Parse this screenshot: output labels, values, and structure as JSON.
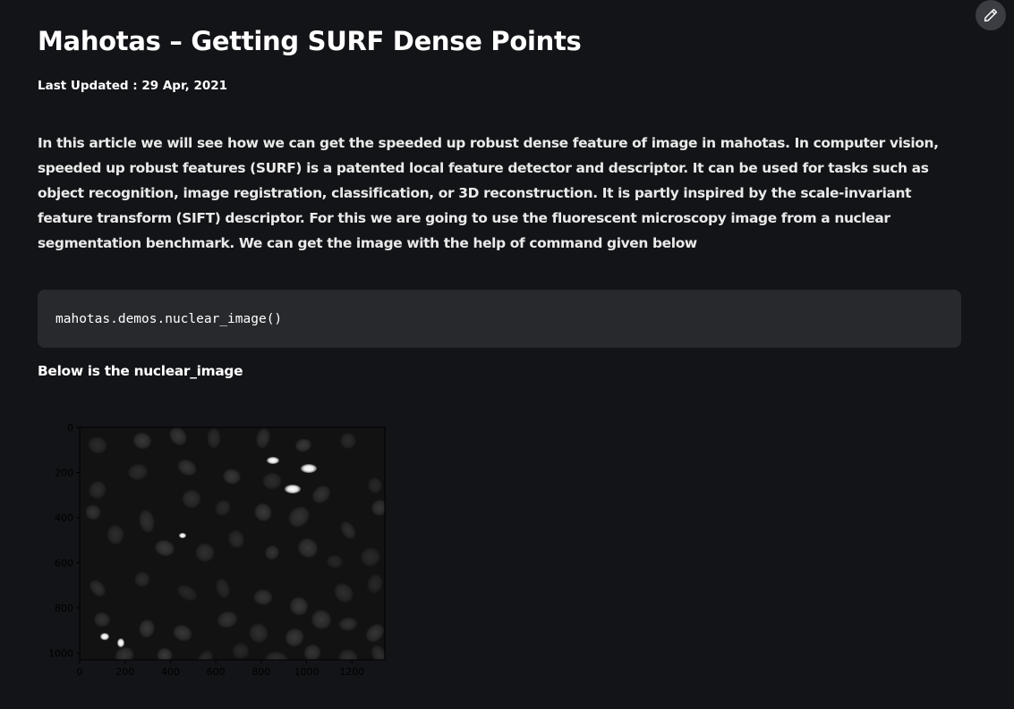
{
  "header": {
    "edit_icon": "pencil-icon"
  },
  "article": {
    "title": "Mahotas – Getting SURF Dense Points",
    "last_updated": "Last Updated : 29 Apr, 2021",
    "intro": "In this article we will see how we can get the speeded up robust dense feature of image in mahotas. In computer vision, speeded up robust features (SURF) is a patented local feature detector and descriptor. It can be used for tasks such as object recognition, image registration, classification, or 3D reconstruction. It is partly inspired by the scale-invariant feature transform (SIFT) descriptor. For this we are going to use the fluorescent microscopy image from a nuclear segmentation benchmark. We can get the image with the help of command given below",
    "code": "mahotas.demos.nuclear_image()",
    "caption": "Below is the nuclear_image"
  },
  "figure": {
    "x_ticks": [
      "0",
      "200",
      "400",
      "600",
      "800",
      "1000",
      "1200"
    ],
    "y_ticks": [
      "0",
      "200",
      "400",
      "600",
      "800",
      "1000"
    ],
    "image_width": 1345,
    "image_height": 1030,
    "colors": {
      "image_background": "#121212",
      "tick_text": "#000000"
    }
  }
}
